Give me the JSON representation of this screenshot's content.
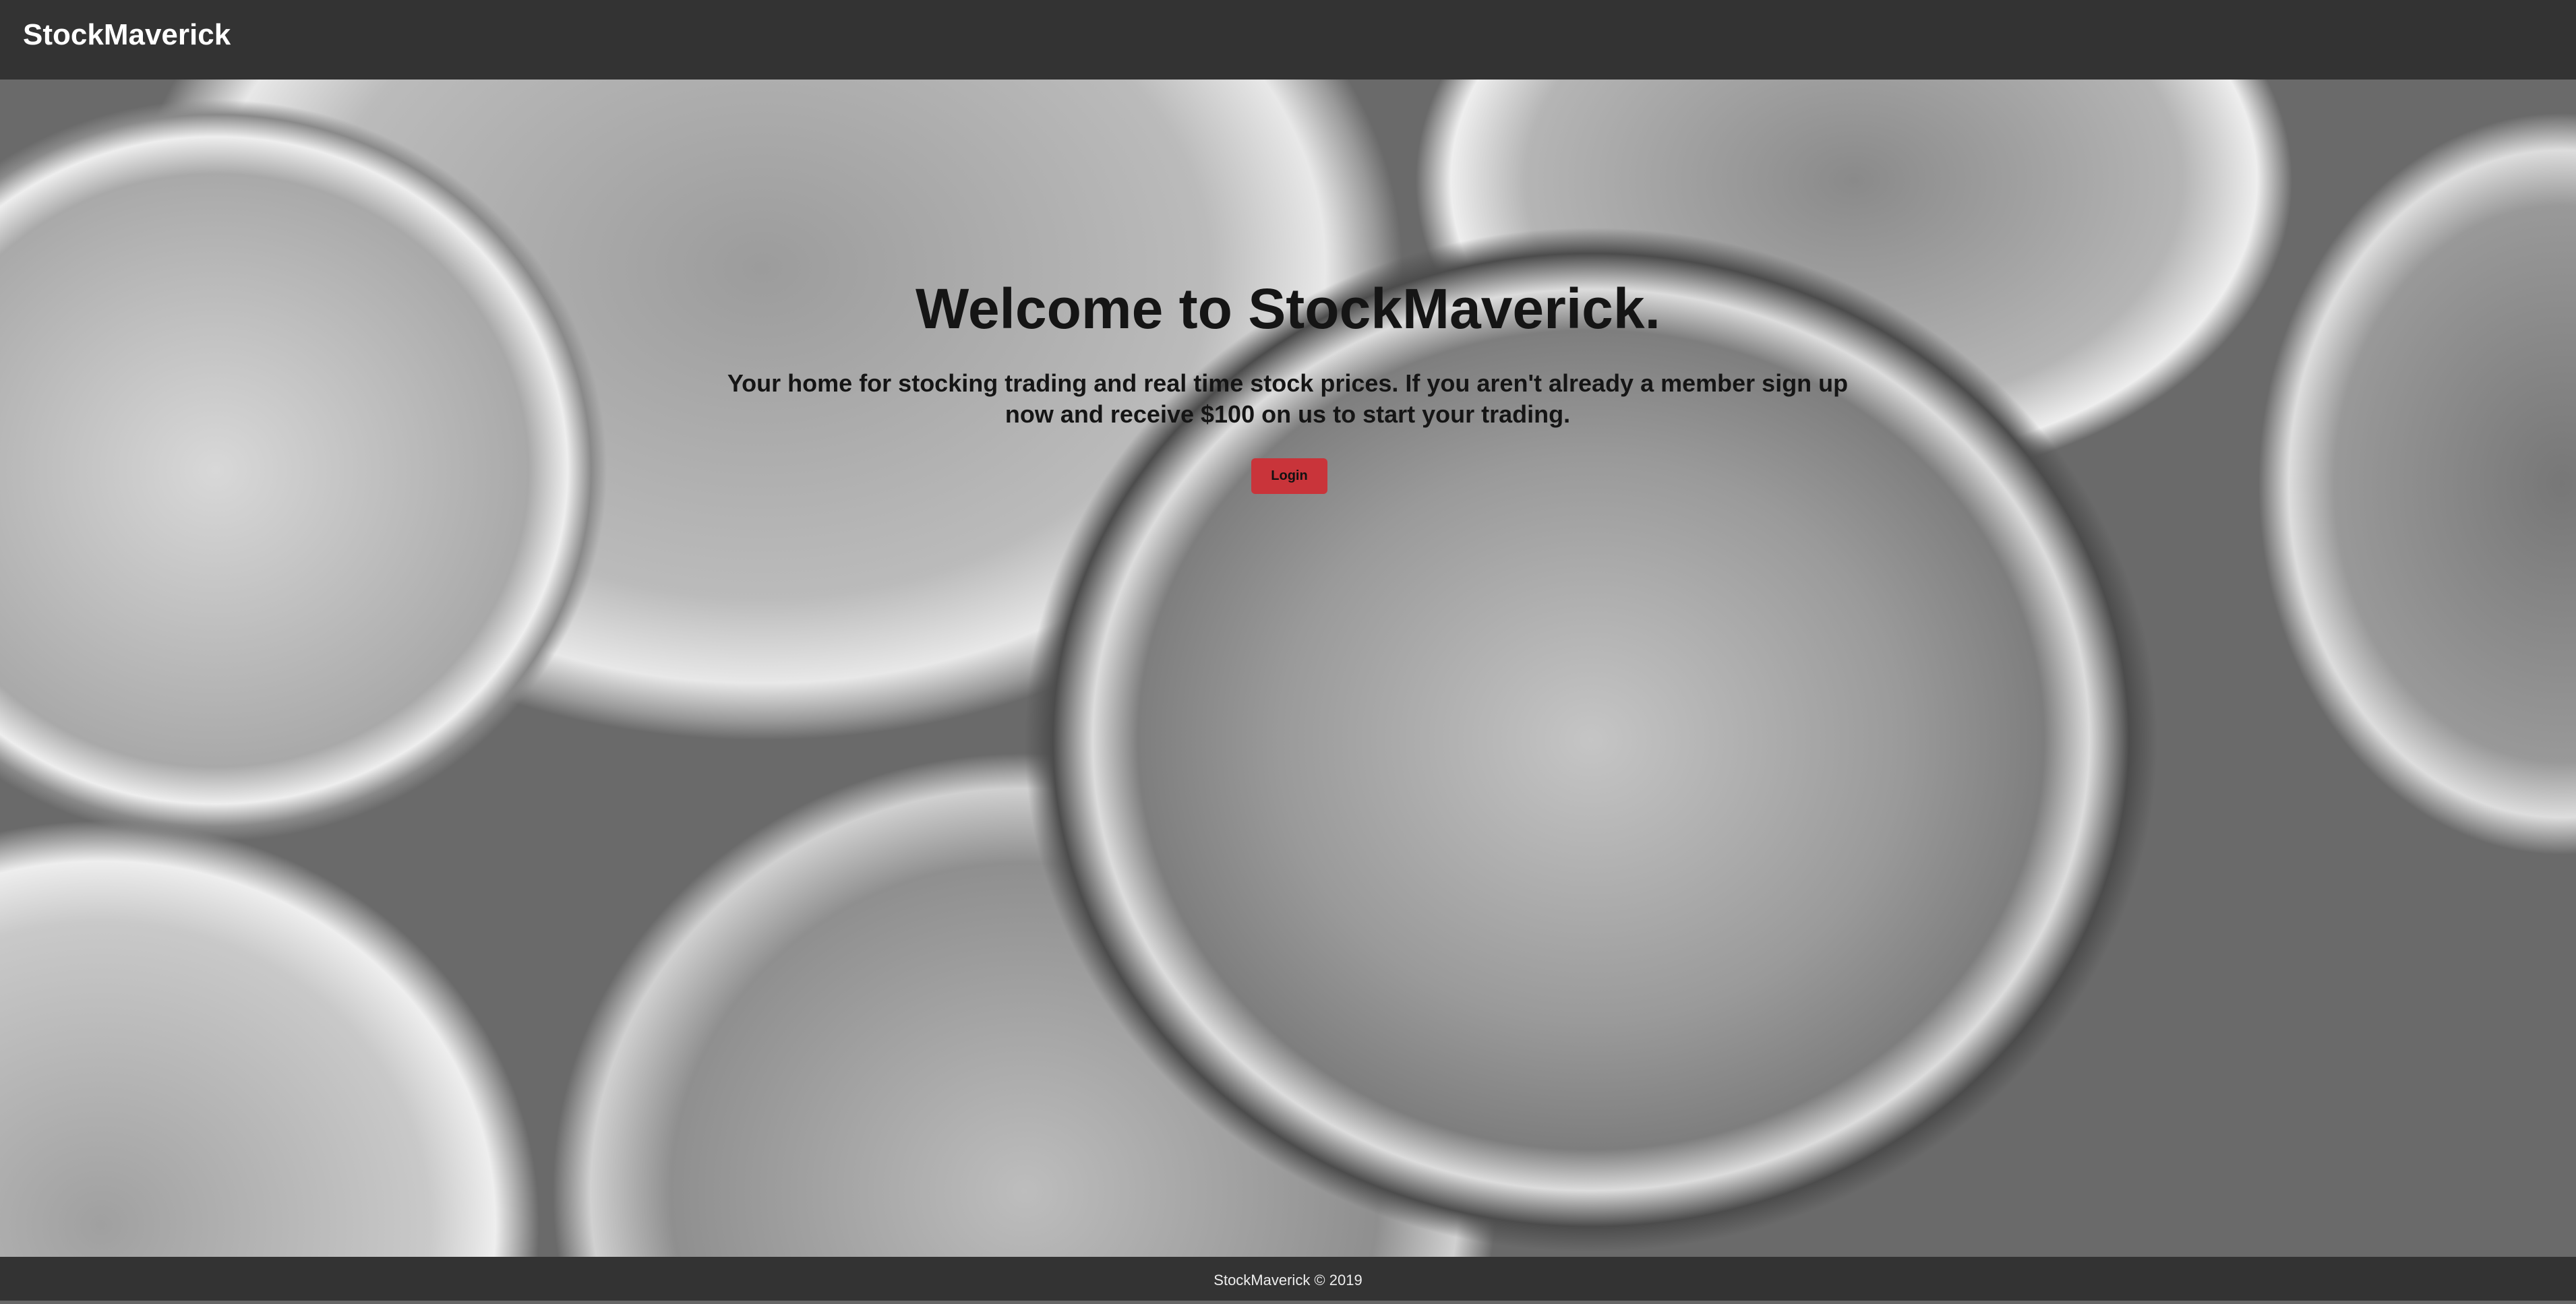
{
  "navbar": {
    "brand": "StockMaverick"
  },
  "hero": {
    "title": "Welcome to StockMaverick.",
    "subtitle": "Your home for stocking trading and real time stock prices. If you aren't already a member sign up now and receive $100 on us to start your trading.",
    "login_label": "Login",
    "login_color": "#c9343a",
    "background": "grayscale-coins-photo"
  },
  "footer": {
    "text": "StockMaverick © 2019"
  }
}
